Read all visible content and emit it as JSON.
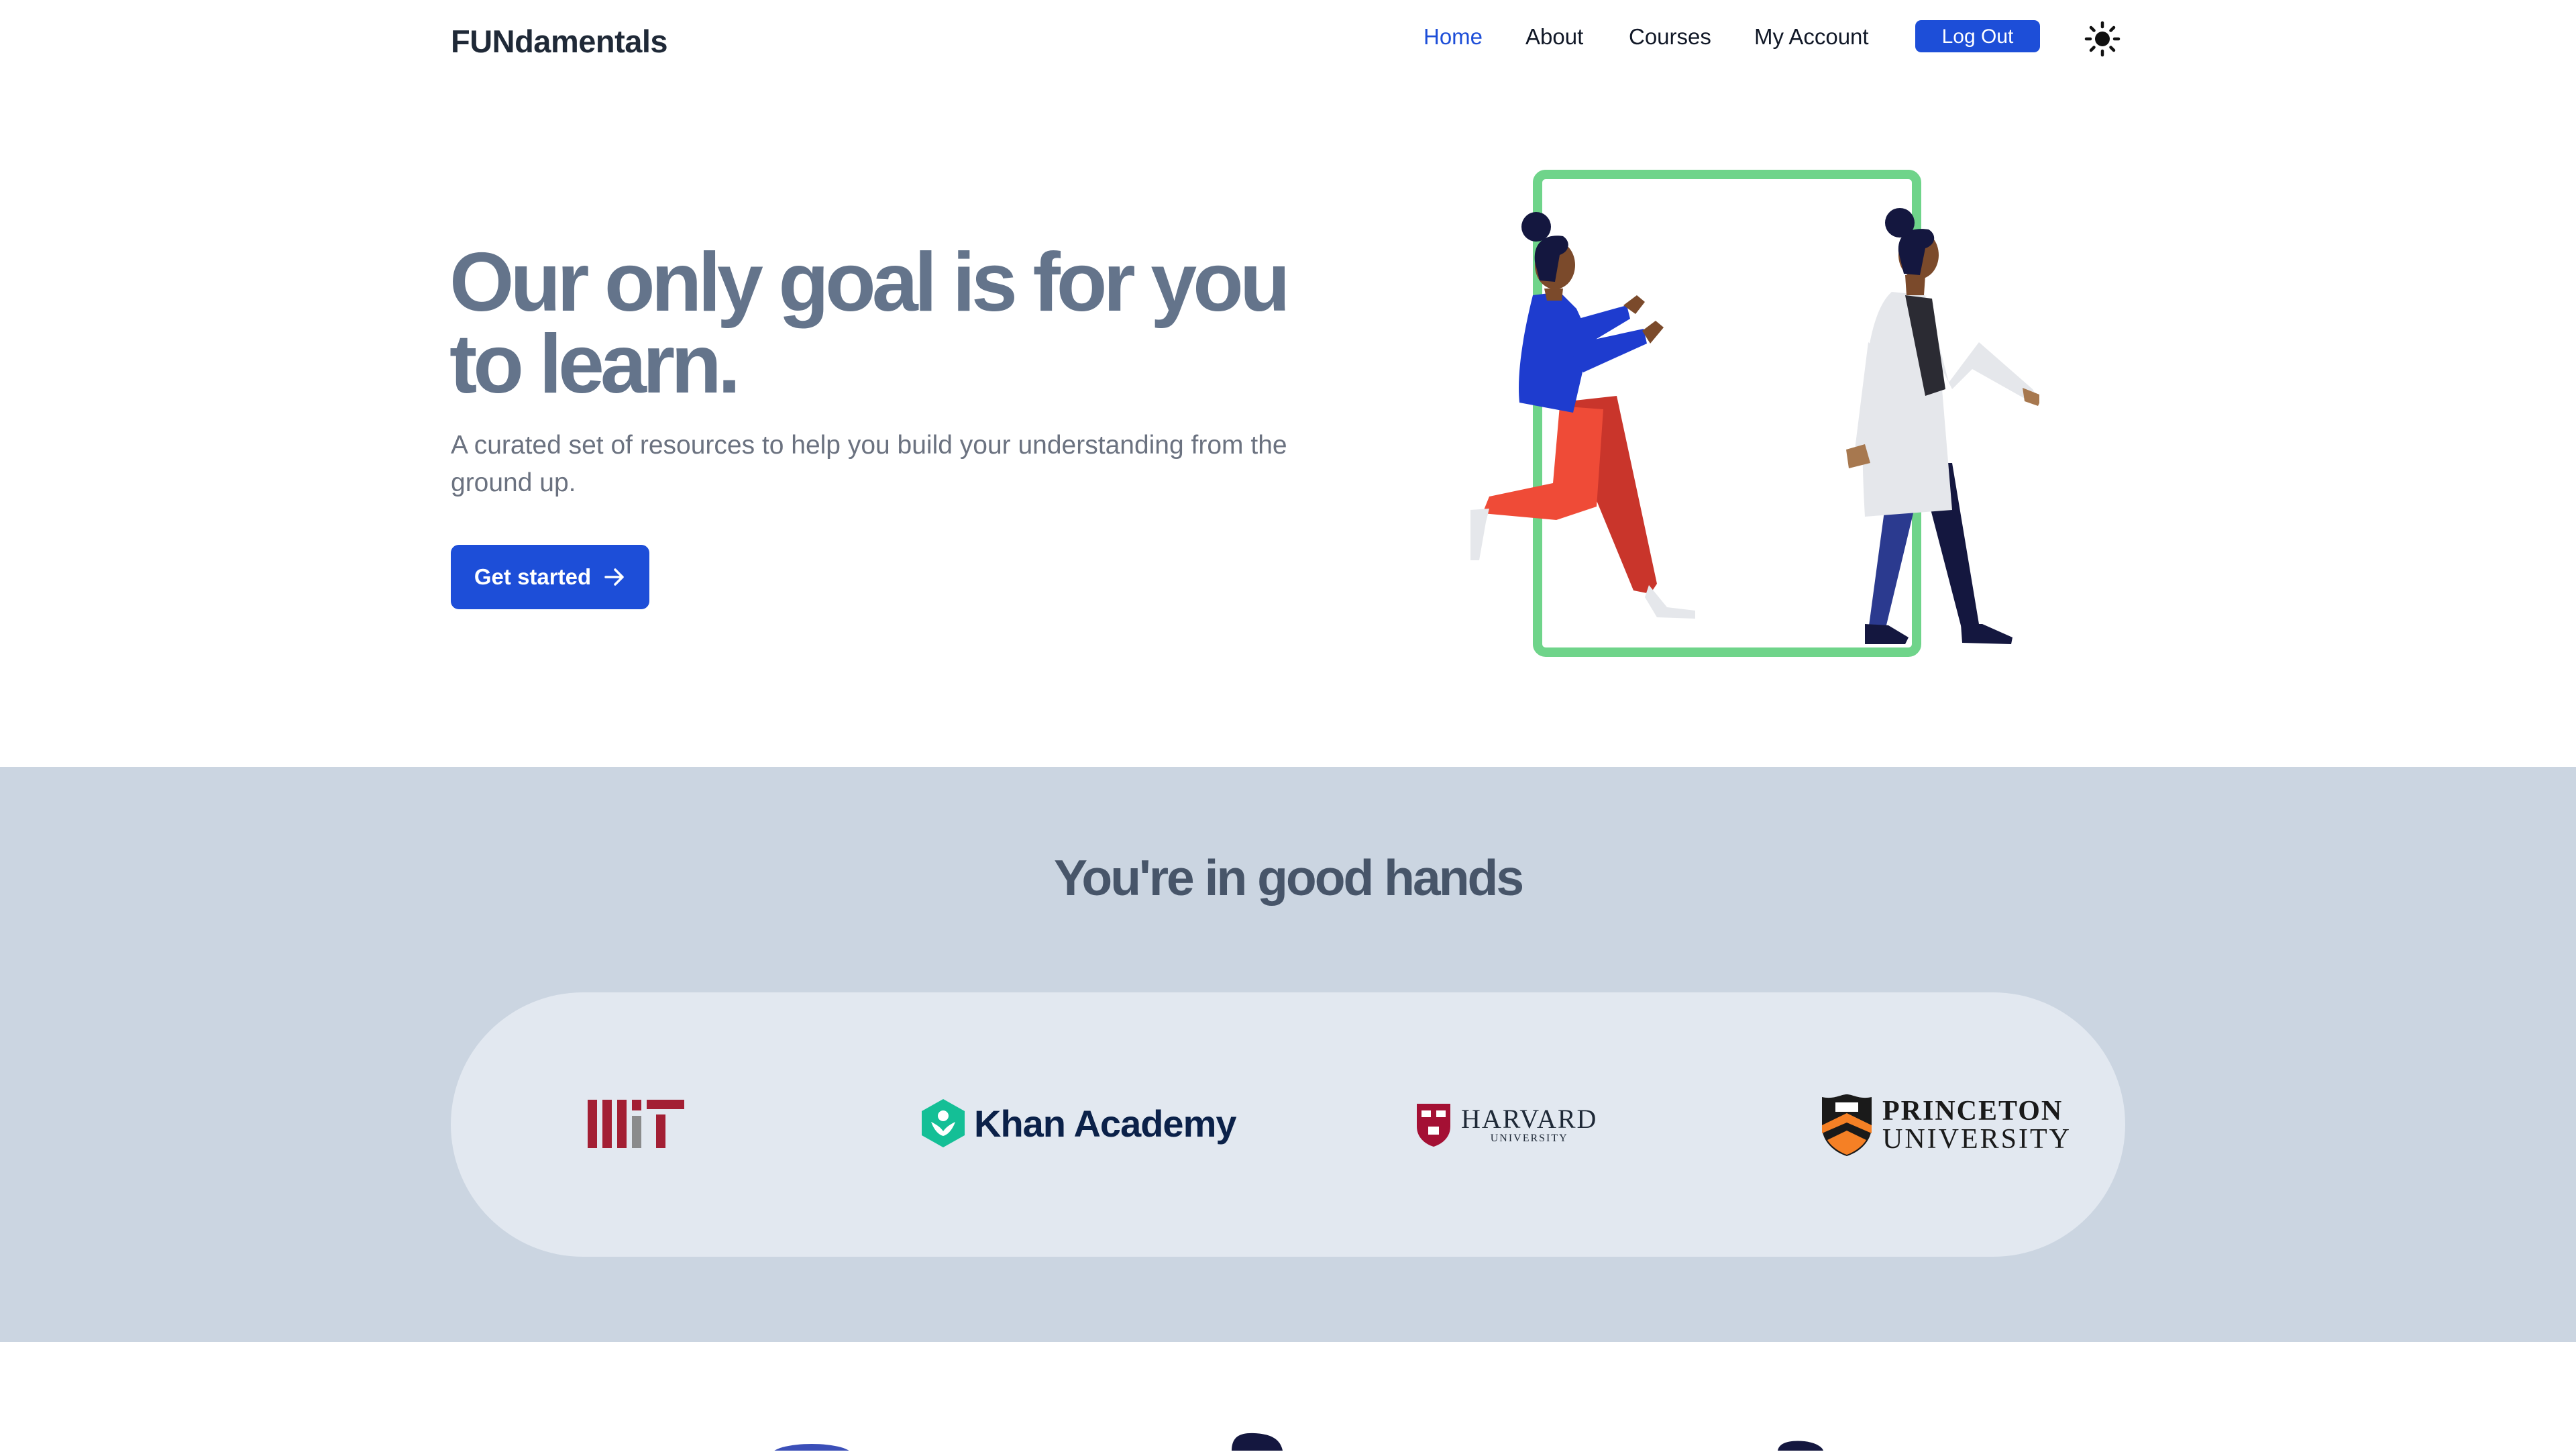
{
  "nav": {
    "brand": "FUNdamentals",
    "links": [
      {
        "label": "Home",
        "active": true
      },
      {
        "label": "About",
        "active": false
      },
      {
        "label": "Courses",
        "active": false
      },
      {
        "label": "My Account",
        "active": false
      }
    ],
    "logout_label": "Log Out",
    "theme_icon": "sun-icon"
  },
  "hero": {
    "title": "Our only goal is for you to learn.",
    "subtitle": "A curated set of resources to help you build your understanding from the ground up.",
    "cta_label": "Get started",
    "cta_icon": "arrow-right-icon",
    "illustration": "two-people-walking-through-door-illustration"
  },
  "trust": {
    "title": "You're in good hands",
    "logos": [
      {
        "name": "MIT",
        "icon": "mit-logo"
      },
      {
        "name": "Khan Academy",
        "wordmark": "Khan Academy",
        "icon": "khan-academy-logo"
      },
      {
        "name": "Harvard University",
        "wordmark": "HARVARD",
        "sub": "UNIVERSITY",
        "icon": "harvard-logo"
      },
      {
        "name": "Princeton University",
        "wordmark": "PRINCETON",
        "sub": "UNIVERSITY",
        "icon": "princeton-logo"
      }
    ]
  },
  "colors": {
    "accent": "#1d4ed8",
    "hero_title": "#64748b",
    "trust_bg": "#cbd5e1",
    "pill_bg": "#e2e8f0",
    "door_frame": "#6fd48a",
    "mit_red": "#a31f34",
    "khan_green": "#14bf96",
    "princeton_orange": "#f58025"
  }
}
